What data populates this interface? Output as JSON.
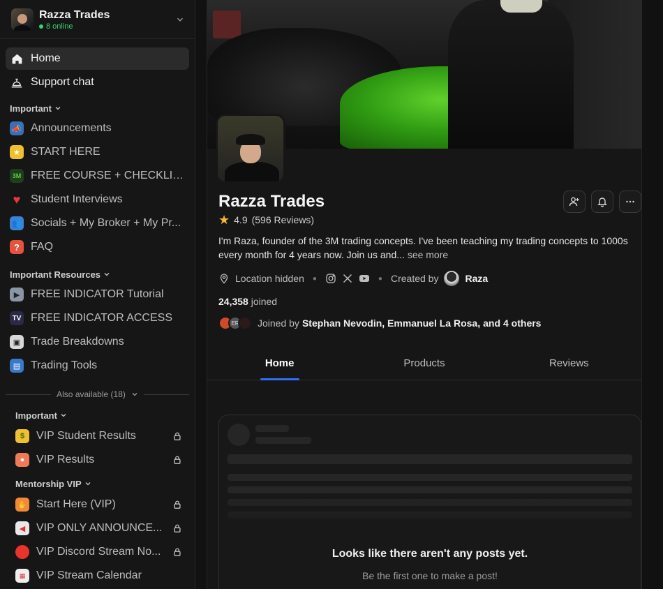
{
  "workspace": {
    "name": "Razza Trades",
    "online": "8 online"
  },
  "nav": {
    "home": "Home",
    "support": "Support chat"
  },
  "important": {
    "title": "Important",
    "items": [
      {
        "label": "Announcements",
        "icon": "megaphone-icon"
      },
      {
        "label": "START HERE",
        "icon": "star-icon"
      },
      {
        "label": "FREE COURSE + CHECKLIST",
        "icon": "3m-logo-icon"
      },
      {
        "label": "Student Interviews",
        "icon": "heart-icon"
      },
      {
        "label": "Socials + My Broker + My Pr...",
        "icon": "people-icon"
      },
      {
        "label": "FAQ",
        "icon": "question-icon"
      }
    ]
  },
  "resources": {
    "title": "Important Resources",
    "items": [
      {
        "label": "FREE INDICATOR Tutorial",
        "icon": "video-camera-icon"
      },
      {
        "label": "FREE INDICATOR ACCESS",
        "icon": "tradingview-icon"
      },
      {
        "label": "Trade Breakdowns",
        "icon": "film-icon"
      },
      {
        "label": "Trading Tools",
        "icon": "books-icon"
      }
    ]
  },
  "also_available": "Also available (18)",
  "locked_important": {
    "title": "Important",
    "items": [
      {
        "label": "VIP Student Results",
        "icon": "money-face-icon"
      },
      {
        "label": "VIP Results",
        "icon": "speech-bubble-icon"
      }
    ]
  },
  "mentorship": {
    "title": "Mentorship VIP",
    "items": [
      {
        "label": "Start Here (VIP)",
        "icon": "wave-hand-icon"
      },
      {
        "label": "VIP ONLY ANNOUNCE...",
        "icon": "loudspeaker-icon"
      },
      {
        "label": "VIP Discord Stream No...",
        "icon": "red-circle-icon"
      },
      {
        "label": "VIP Stream Calendar",
        "icon": "calendar-icon"
      }
    ]
  },
  "profile": {
    "title": "Razza Trades",
    "rating": "4.9",
    "reviews": "(596 Reviews)",
    "description": "I'm Raza, founder of the 3M trading concepts. I've been teaching my trading concepts to 1000s every month for 4 years now. Join us and...",
    "see_more": "see more",
    "location": "Location hidden",
    "created_by_label": "Created by",
    "creator": "Raza",
    "joined_count": "24,358",
    "joined_label": "joined",
    "joined_by_label": "Joined by",
    "joined_by_names": "Stephan Nevodin, Emmanuel La Rosa,",
    "joined_by_and": "and",
    "joined_by_others": "4 others",
    "avatar_initials": "ER"
  },
  "tabs": [
    {
      "label": "Home",
      "active": true
    },
    {
      "label": "Products",
      "active": false
    },
    {
      "label": "Reviews",
      "active": false
    }
  ],
  "empty": {
    "title": "Looks like there aren't any posts yet.",
    "subtitle": "Be the first one to make a post!"
  },
  "colors": {
    "accent": "#2f6ff5",
    "online": "#3fcf6e",
    "star": "#f5b92a"
  }
}
